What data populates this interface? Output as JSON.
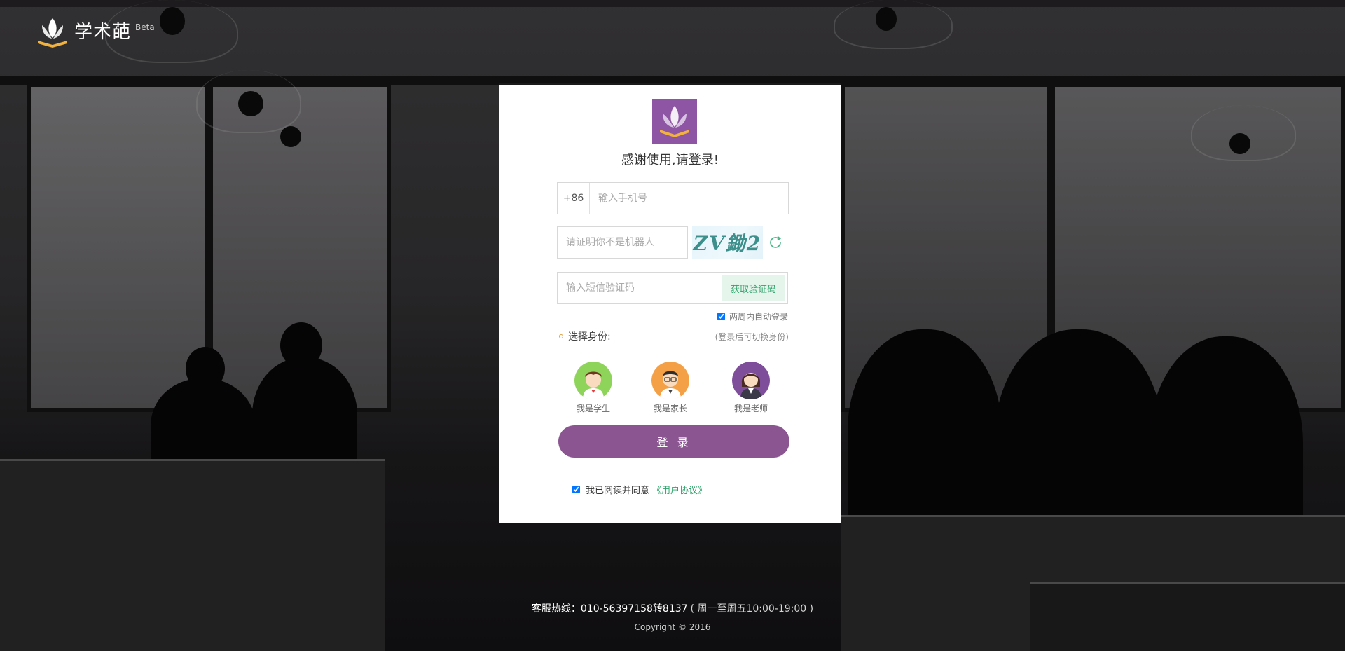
{
  "brand": {
    "name": "学术葩",
    "badge": "Beta"
  },
  "card": {
    "title": "感谢使用,请登录!",
    "phone": {
      "prefix": "+86",
      "placeholder": "输入手机号",
      "value": ""
    },
    "captcha": {
      "placeholder": "请证明你不是机器人",
      "image_text": "ZV鋤2",
      "refresh_icon": "refresh-icon"
    },
    "sms": {
      "placeholder": "输入短信验证码",
      "button": "获取验证码"
    },
    "remember": {
      "label": "两周内自动登录",
      "checked": true
    },
    "role": {
      "label": "选择身份:",
      "hint": "(登录后可切换身份)",
      "options": [
        {
          "label": "我是学生",
          "avatar": "student-avatar",
          "color": "#8ed35a"
        },
        {
          "label": "我是家长",
          "avatar": "parent-avatar",
          "color": "#f3a046"
        },
        {
          "label": "我是老师",
          "avatar": "teacher-avatar",
          "color": "#7e4e9b"
        }
      ]
    },
    "login_button": "登 录",
    "agreement": {
      "prefix": "我已阅读并同意",
      "link": "《用户协议》",
      "checked": true
    }
  },
  "footer": {
    "hotline": "客服热线：010-56397158转8137",
    "hours": "( 周一至周五10:00-19:00 )",
    "copyright": "Copyright © 2016"
  },
  "colors": {
    "accent": "#8a5591",
    "logo_bg": "#8d55a3",
    "link": "#2fa36b"
  }
}
